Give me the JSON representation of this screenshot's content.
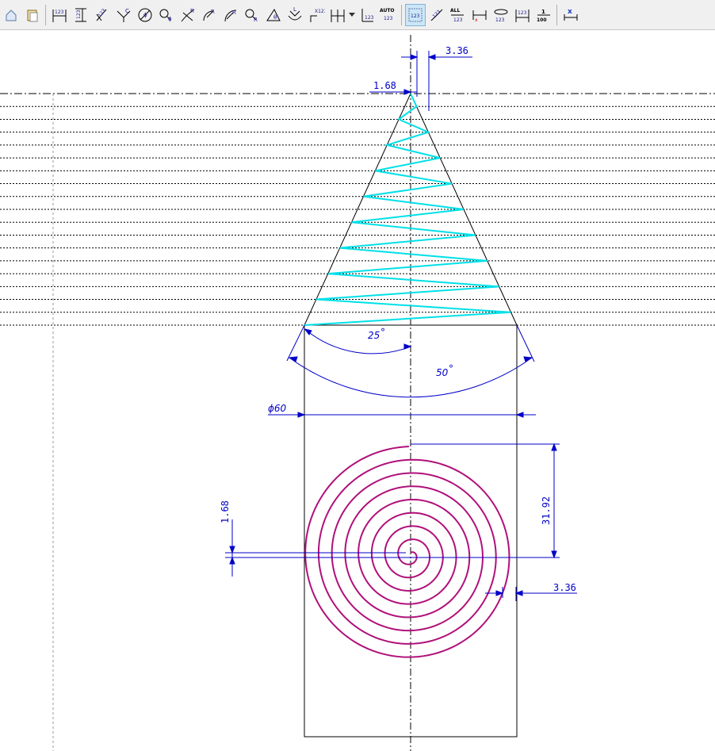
{
  "toolbar": {
    "buttons": [
      {
        "name": "home-icon"
      },
      {
        "name": "paste-icon"
      },
      {
        "name": "dim-horizontal-icon"
      },
      {
        "name": "dim-vertical-icon"
      },
      {
        "name": "dim-aligned-icon"
      },
      {
        "name": "chamfer-dim-icon"
      },
      {
        "name": "diameter-dim-icon"
      },
      {
        "name": "zoom-diameter-icon"
      },
      {
        "name": "radius-dim-icon"
      },
      {
        "name": "radius-leader-icon"
      },
      {
        "name": "radius-offset-icon"
      },
      {
        "name": "zoom-radius-icon"
      },
      {
        "name": "angle-dim-icon"
      },
      {
        "name": "arc-length-dim-icon"
      },
      {
        "name": "coordinate-dim-icon"
      },
      {
        "name": "serial-dim-icon"
      },
      {
        "name": "baseline-dim-icon"
      },
      {
        "name": "auto-dim-icon"
      },
      {
        "name": "dim-edit-icon"
      },
      {
        "name": "dim-rotate-icon"
      },
      {
        "name": "all-dim-icon"
      },
      {
        "name": "dim-clear-icon"
      },
      {
        "name": "dim-symmetric-icon"
      },
      {
        "name": "dim-spacing-icon"
      },
      {
        "name": "scale-icon"
      },
      {
        "name": "dim-delete-icon"
      }
    ],
    "labels": {
      "num": "123",
      "auto": "AUTO",
      "all": "ALL",
      "coord": "X123",
      "scale_top": "1",
      "scale_bottom": "100"
    }
  },
  "drawing": {
    "colors": {
      "dimension": "#0000c8",
      "cone_spiral": "#00e0e8",
      "flat_spiral": "#b0107a",
      "outline": "#000000"
    },
    "dimensions": {
      "top_pitch": "3.36",
      "top_half_pitch": "1.68",
      "half_angle": "25",
      "full_angle": "50",
      "diameter": "ϕ60",
      "left_half_pitch": "1.68",
      "radius": "31.92",
      "right_pitch": "3.36"
    }
  }
}
